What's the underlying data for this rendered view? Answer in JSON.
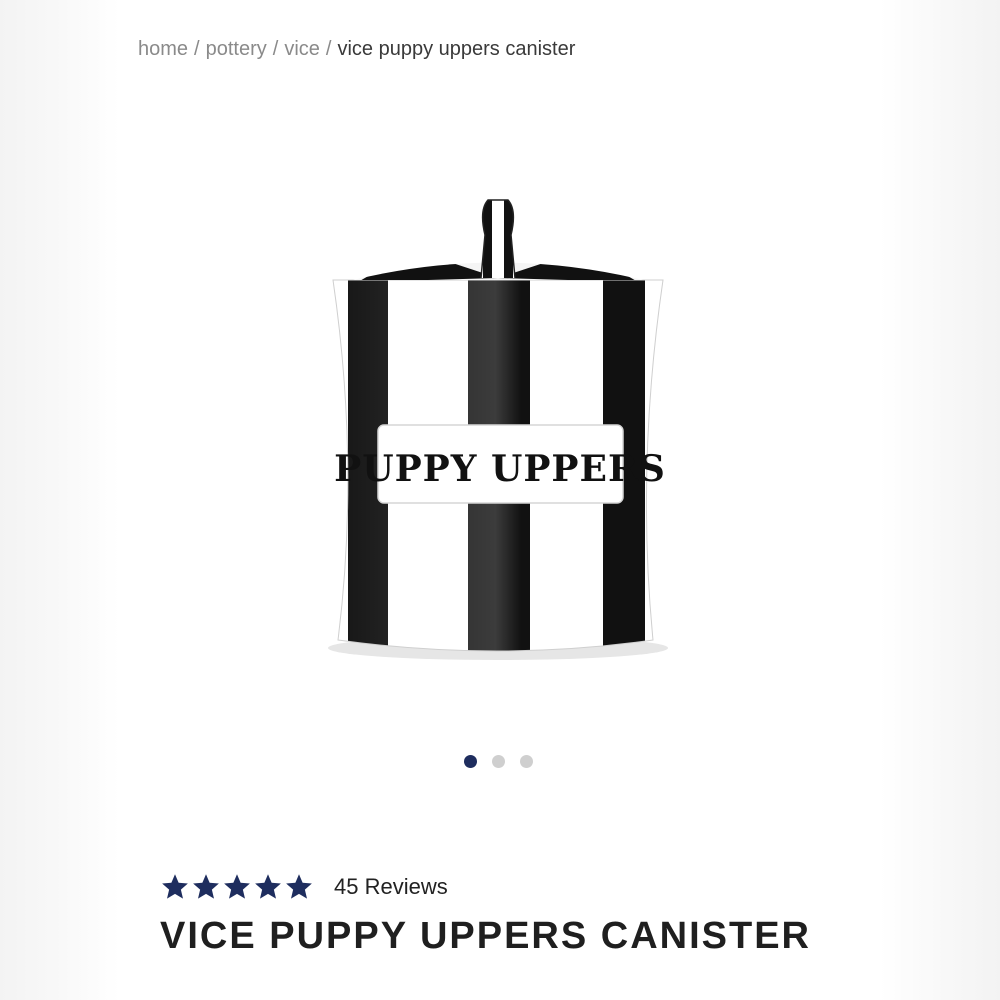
{
  "breadcrumb": {
    "items": [
      {
        "label": "home"
      },
      {
        "label": "pottery"
      },
      {
        "label": "vice"
      }
    ],
    "separator": "/",
    "current": "vice puppy uppers canister"
  },
  "product": {
    "image_label": "PUPPY UPPERS",
    "title": "VICE PUPPY UPPERS CANISTER",
    "rating": 5,
    "rating_max": 5,
    "reviews_label": "45 Reviews",
    "star_color": "#1e2d5e"
  },
  "carousel": {
    "count": 3,
    "active_index": 0,
    "active_color": "#1e2d5e",
    "inactive_color": "#cfcfcf"
  }
}
